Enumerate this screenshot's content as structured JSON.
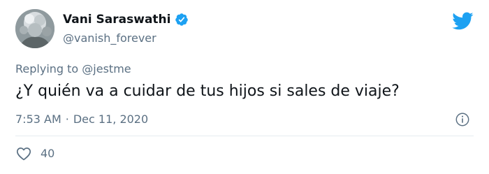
{
  "author": {
    "display_name": "Vani Saraswathi",
    "handle": "@vanish_forever",
    "verified": true,
    "avatar_icon": "avatar"
  },
  "brand": {
    "icon": "twitter-bird-icon",
    "color": "#1da1f2"
  },
  "reply_context": {
    "prefix": "Replying to",
    "mention": "@jestme"
  },
  "tweet": {
    "text": "¿Y quién va a cuidar de tus hijos si sales de viaje?",
    "time": "7:53 AM",
    "separator": "·",
    "date": "Dec 11, 2020"
  },
  "actions": {
    "like_icon": "heart-icon",
    "like_count": "40",
    "info_icon": "info-icon"
  },
  "colors": {
    "text_primary": "#0f1419",
    "text_secondary": "#5b7083",
    "verified_badge": "#1da1f2",
    "divider": "#e6ecf0"
  }
}
